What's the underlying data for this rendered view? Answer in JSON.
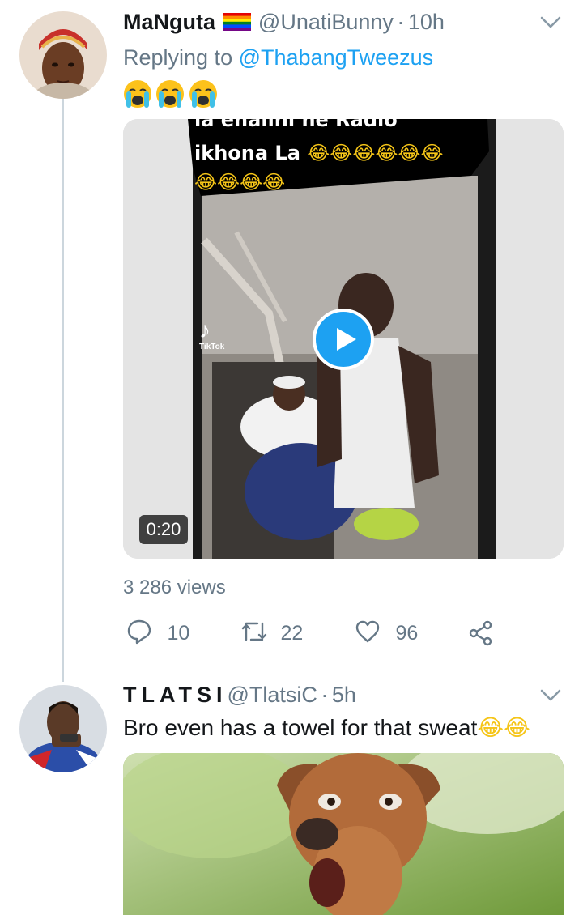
{
  "tweet1": {
    "display_name": "MaNguta",
    "flag_icon": "rainbow-flag-icon",
    "handle": "@UnatiBunny",
    "separator": "·",
    "time": "10h",
    "replying_prefix": "Replying to",
    "replying_to": "@ThabangTweezus",
    "emoji_text": "loudly-crying-face x3",
    "video": {
      "caption_line1": "la enalini ne Radio",
      "caption_line2": "ikhona La",
      "watermark": "TikTok",
      "duration": "0:20"
    },
    "views": "3 286 views",
    "actions": {
      "replies": "10",
      "retweets": "22",
      "likes": "96"
    }
  },
  "tweet2": {
    "display_name": "TLATSI",
    "handle": "@TlatsiC",
    "separator": "·",
    "time": "5h",
    "text": "Bro even has a towel for that sweat"
  },
  "colors": {
    "accent": "#1da1f2",
    "secondary_text": "#657786",
    "primary_text": "#14171a",
    "thread_line": "#ccd6dd"
  }
}
